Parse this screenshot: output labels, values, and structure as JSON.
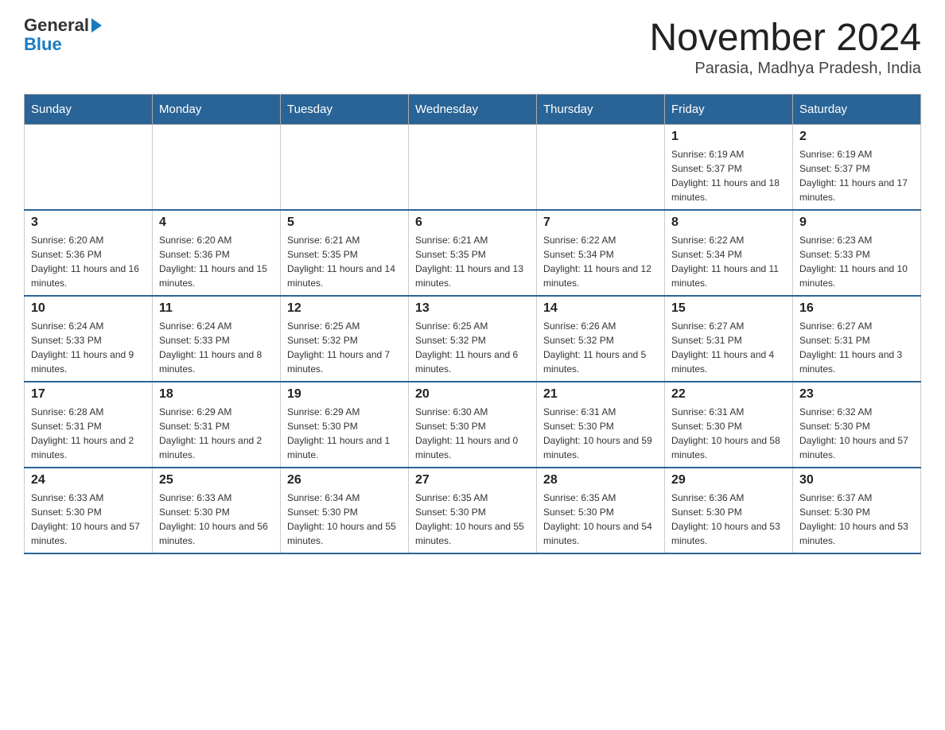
{
  "header": {
    "logo": {
      "general": "General",
      "blue": "Blue",
      "arrow": "▶"
    },
    "title": "November 2024",
    "subtitle": "Parasia, Madhya Pradesh, India"
  },
  "days_of_week": [
    "Sunday",
    "Monday",
    "Tuesday",
    "Wednesday",
    "Thursday",
    "Friday",
    "Saturday"
  ],
  "weeks": [
    [
      {
        "day": "",
        "info": ""
      },
      {
        "day": "",
        "info": ""
      },
      {
        "day": "",
        "info": ""
      },
      {
        "day": "",
        "info": ""
      },
      {
        "day": "",
        "info": ""
      },
      {
        "day": "1",
        "info": "Sunrise: 6:19 AM\nSunset: 5:37 PM\nDaylight: 11 hours and 18 minutes."
      },
      {
        "day": "2",
        "info": "Sunrise: 6:19 AM\nSunset: 5:37 PM\nDaylight: 11 hours and 17 minutes."
      }
    ],
    [
      {
        "day": "3",
        "info": "Sunrise: 6:20 AM\nSunset: 5:36 PM\nDaylight: 11 hours and 16 minutes."
      },
      {
        "day": "4",
        "info": "Sunrise: 6:20 AM\nSunset: 5:36 PM\nDaylight: 11 hours and 15 minutes."
      },
      {
        "day": "5",
        "info": "Sunrise: 6:21 AM\nSunset: 5:35 PM\nDaylight: 11 hours and 14 minutes."
      },
      {
        "day": "6",
        "info": "Sunrise: 6:21 AM\nSunset: 5:35 PM\nDaylight: 11 hours and 13 minutes."
      },
      {
        "day": "7",
        "info": "Sunrise: 6:22 AM\nSunset: 5:34 PM\nDaylight: 11 hours and 12 minutes."
      },
      {
        "day": "8",
        "info": "Sunrise: 6:22 AM\nSunset: 5:34 PM\nDaylight: 11 hours and 11 minutes."
      },
      {
        "day": "9",
        "info": "Sunrise: 6:23 AM\nSunset: 5:33 PM\nDaylight: 11 hours and 10 minutes."
      }
    ],
    [
      {
        "day": "10",
        "info": "Sunrise: 6:24 AM\nSunset: 5:33 PM\nDaylight: 11 hours and 9 minutes."
      },
      {
        "day": "11",
        "info": "Sunrise: 6:24 AM\nSunset: 5:33 PM\nDaylight: 11 hours and 8 minutes."
      },
      {
        "day": "12",
        "info": "Sunrise: 6:25 AM\nSunset: 5:32 PM\nDaylight: 11 hours and 7 minutes."
      },
      {
        "day": "13",
        "info": "Sunrise: 6:25 AM\nSunset: 5:32 PM\nDaylight: 11 hours and 6 minutes."
      },
      {
        "day": "14",
        "info": "Sunrise: 6:26 AM\nSunset: 5:32 PM\nDaylight: 11 hours and 5 minutes."
      },
      {
        "day": "15",
        "info": "Sunrise: 6:27 AM\nSunset: 5:31 PM\nDaylight: 11 hours and 4 minutes."
      },
      {
        "day": "16",
        "info": "Sunrise: 6:27 AM\nSunset: 5:31 PM\nDaylight: 11 hours and 3 minutes."
      }
    ],
    [
      {
        "day": "17",
        "info": "Sunrise: 6:28 AM\nSunset: 5:31 PM\nDaylight: 11 hours and 2 minutes."
      },
      {
        "day": "18",
        "info": "Sunrise: 6:29 AM\nSunset: 5:31 PM\nDaylight: 11 hours and 2 minutes."
      },
      {
        "day": "19",
        "info": "Sunrise: 6:29 AM\nSunset: 5:30 PM\nDaylight: 11 hours and 1 minute."
      },
      {
        "day": "20",
        "info": "Sunrise: 6:30 AM\nSunset: 5:30 PM\nDaylight: 11 hours and 0 minutes."
      },
      {
        "day": "21",
        "info": "Sunrise: 6:31 AM\nSunset: 5:30 PM\nDaylight: 10 hours and 59 minutes."
      },
      {
        "day": "22",
        "info": "Sunrise: 6:31 AM\nSunset: 5:30 PM\nDaylight: 10 hours and 58 minutes."
      },
      {
        "day": "23",
        "info": "Sunrise: 6:32 AM\nSunset: 5:30 PM\nDaylight: 10 hours and 57 minutes."
      }
    ],
    [
      {
        "day": "24",
        "info": "Sunrise: 6:33 AM\nSunset: 5:30 PM\nDaylight: 10 hours and 57 minutes."
      },
      {
        "day": "25",
        "info": "Sunrise: 6:33 AM\nSunset: 5:30 PM\nDaylight: 10 hours and 56 minutes."
      },
      {
        "day": "26",
        "info": "Sunrise: 6:34 AM\nSunset: 5:30 PM\nDaylight: 10 hours and 55 minutes."
      },
      {
        "day": "27",
        "info": "Sunrise: 6:35 AM\nSunset: 5:30 PM\nDaylight: 10 hours and 55 minutes."
      },
      {
        "day": "28",
        "info": "Sunrise: 6:35 AM\nSunset: 5:30 PM\nDaylight: 10 hours and 54 minutes."
      },
      {
        "day": "29",
        "info": "Sunrise: 6:36 AM\nSunset: 5:30 PM\nDaylight: 10 hours and 53 minutes."
      },
      {
        "day": "30",
        "info": "Sunrise: 6:37 AM\nSunset: 5:30 PM\nDaylight: 10 hours and 53 minutes."
      }
    ]
  ]
}
